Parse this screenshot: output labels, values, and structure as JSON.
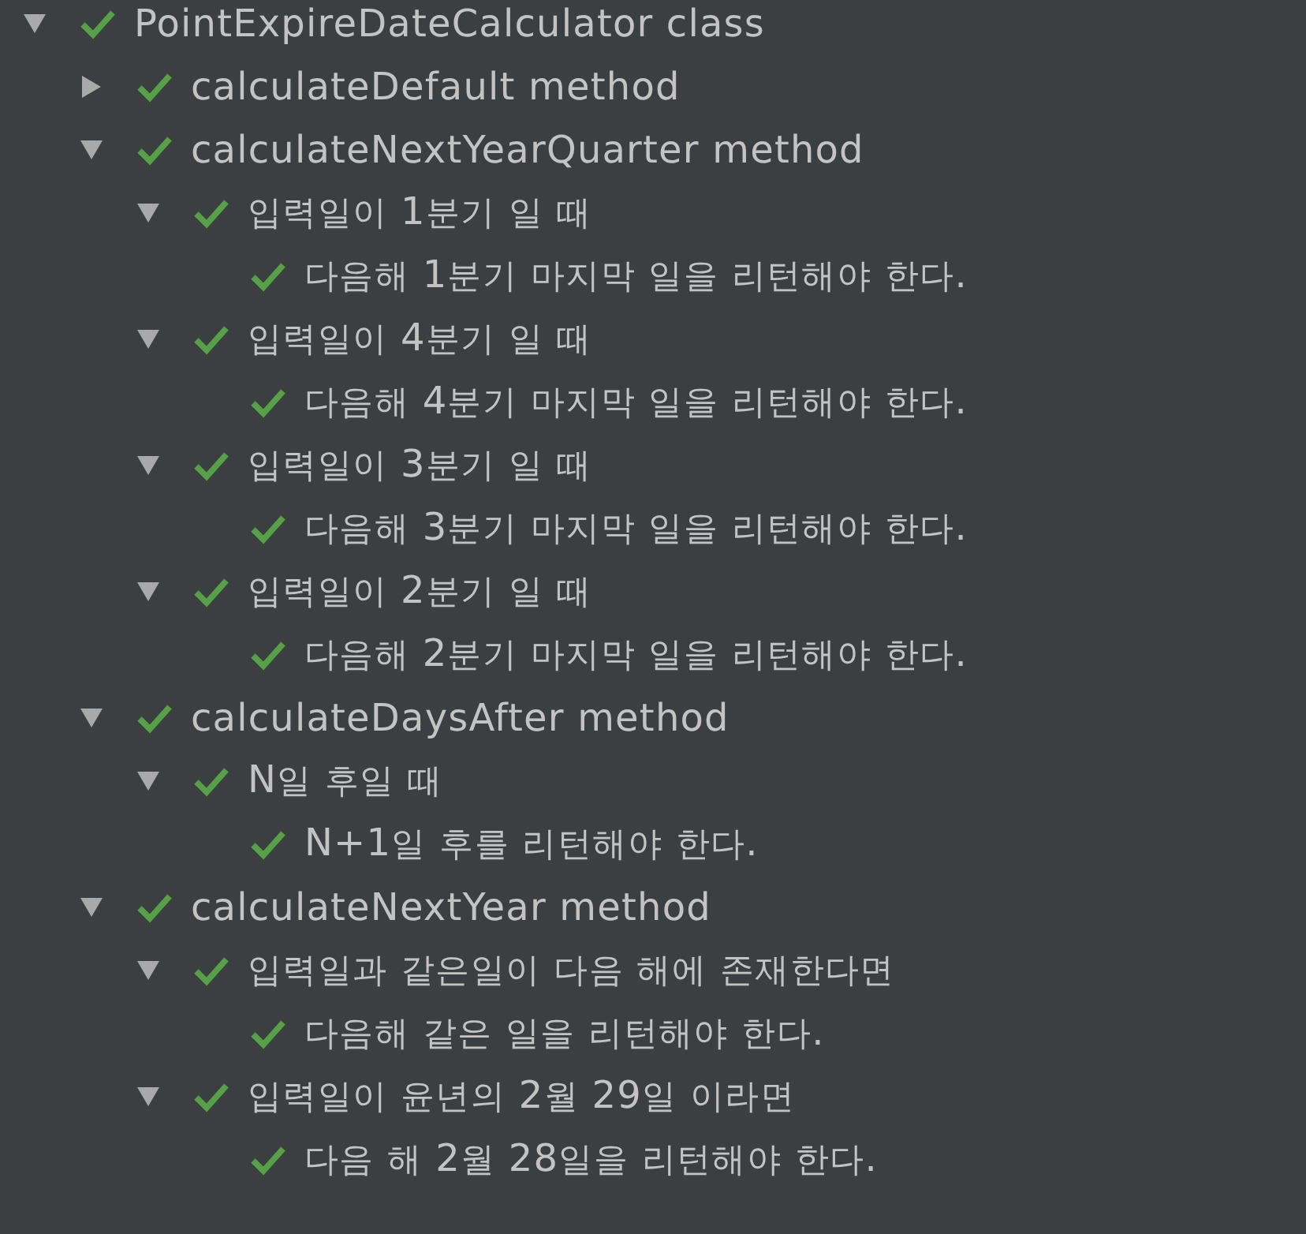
{
  "test_tree": [
    {
      "label": "PointExpireDateCalculator class",
      "expanded": true,
      "children": [
        {
          "label": "calculateDefault method",
          "expanded": false
        },
        {
          "label": "calculateNextYearQuarter method",
          "expanded": true,
          "children": [
            {
              "label": "입력일이 1분기 일 때",
              "expanded": true,
              "children": [
                {
                  "label": "다음해 1분기 마지막 일을 리턴해야 한다."
                }
              ]
            },
            {
              "label": "입력일이 4분기 일 때",
              "expanded": true,
              "children": [
                {
                  "label": "다음해 4분기 마지막 일을 리턴해야 한다."
                }
              ]
            },
            {
              "label": "입력일이 3분기 일 때",
              "expanded": true,
              "children": [
                {
                  "label": "다음해 3분기 마지막 일을 리턴해야 한다."
                }
              ]
            },
            {
              "label": "입력일이 2분기 일 때",
              "expanded": true,
              "children": [
                {
                  "label": "다음해 2분기 마지막 일을 리턴해야 한다."
                }
              ]
            }
          ]
        },
        {
          "label": "calculateDaysAfter method",
          "expanded": true,
          "children": [
            {
              "label": "N일 후일 때",
              "expanded": true,
              "children": [
                {
                  "label": "N+1일 후를 리턴해야 한다."
                }
              ]
            }
          ]
        },
        {
          "label": "calculateNextYear method",
          "expanded": true,
          "children": [
            {
              "label": "입력일과 같은일이 다음 해에 존재한다면",
              "expanded": true,
              "children": [
                {
                  "label": "다음해 같은 일을 리턴해야 한다."
                }
              ]
            },
            {
              "label": "입력일이 윤년의 2월 29일 이라면",
              "expanded": true,
              "children": [
                {
                  "label": "다음 해 2월 28일을 리턴해야 한다."
                }
              ]
            }
          ]
        }
      ]
    }
  ]
}
